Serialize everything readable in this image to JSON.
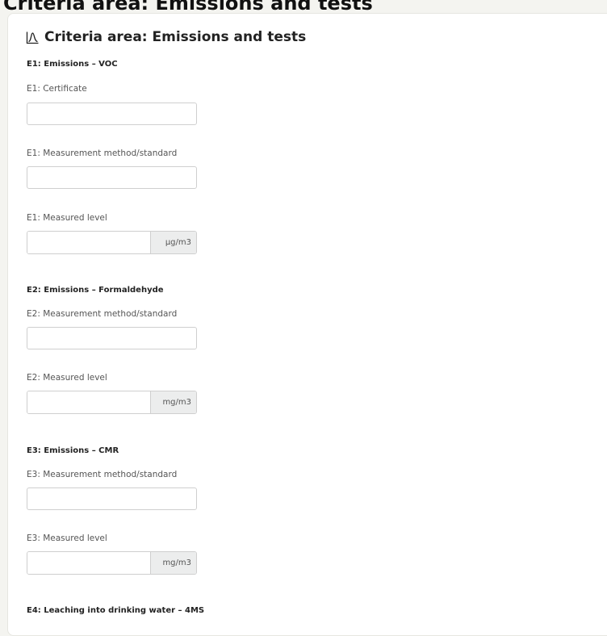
{
  "page_heading": "Criteria area: Emissions and tests",
  "section": {
    "title": "Criteria area: Emissions and tests",
    "icon": "chart-peak-icon"
  },
  "groups": [
    {
      "title": "E1: Emissions – VOC",
      "fields": [
        {
          "label": "E1: Certificate",
          "value": ""
        },
        {
          "label": "E1: Measurement method/standard",
          "value": ""
        },
        {
          "label": "E1: Measured level",
          "value": "",
          "unit": "μg/m3"
        }
      ]
    },
    {
      "title": "E2: Emissions – Formaldehyde",
      "fields": [
        {
          "label": "E2: Measurement method/standard",
          "value": ""
        },
        {
          "label": "E2: Measured level",
          "value": "",
          "unit": "mg/m3"
        }
      ]
    },
    {
      "title": "E3: Emissions – CMR",
      "fields": [
        {
          "label": "E3: Measurement method/standard",
          "value": ""
        },
        {
          "label": "E3: Measured level",
          "value": "",
          "unit": "mg/m3"
        }
      ]
    },
    {
      "title": "E4: Leaching into drinking water – 4MS"
    }
  ]
}
